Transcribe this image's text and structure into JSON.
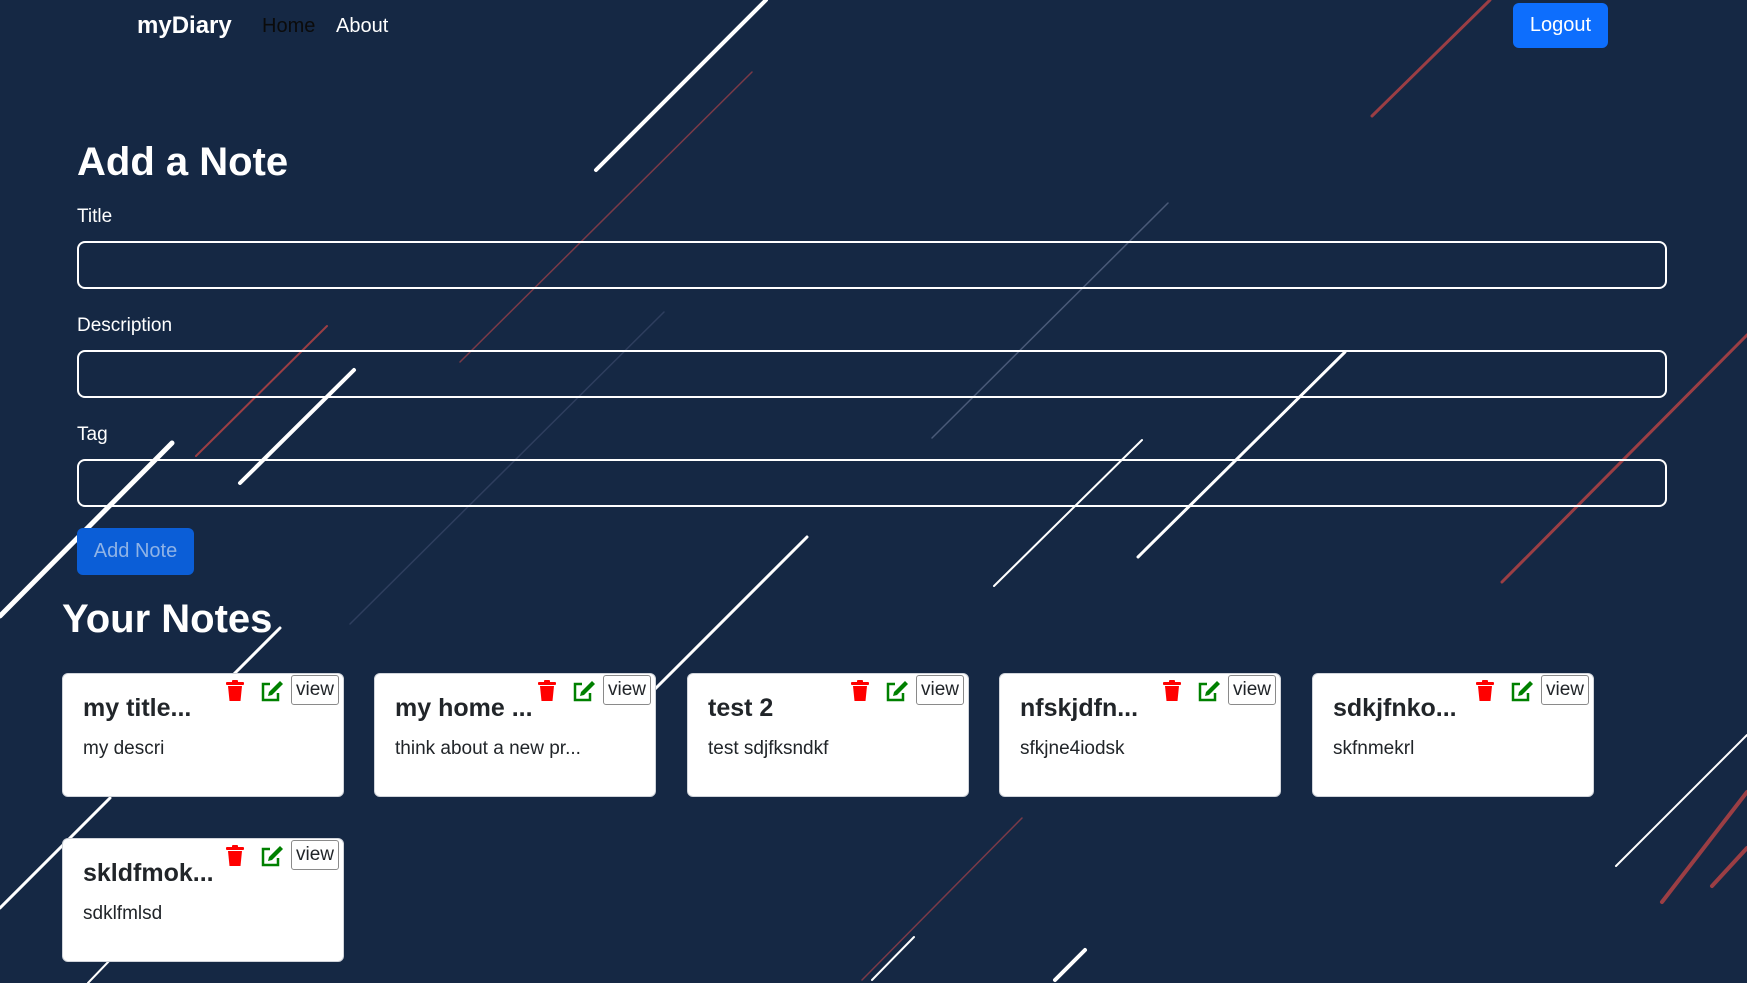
{
  "navbar": {
    "brand": "myDiary",
    "links": [
      "Home",
      "About"
    ],
    "logout_label": "Logout"
  },
  "form": {
    "heading": "Add a Note",
    "title_label": "Title",
    "title_value": "",
    "description_label": "Description",
    "description_value": "",
    "tag_label": "Tag",
    "tag_value": "",
    "submit_label": "Add Note"
  },
  "notes": {
    "heading": "Your Notes",
    "view_label": "view",
    "items": [
      {
        "title": "my title...",
        "description": "my descri"
      },
      {
        "title": "my home ...",
        "description": "think about a new pr..."
      },
      {
        "title": "test 2",
        "description": "test sdjfksndkf"
      },
      {
        "title": "nfskjdfn...",
        "description": "sfkjne4iodsk"
      },
      {
        "title": "sdkjfnko...",
        "description": "skfnmekrl"
      },
      {
        "title": "skldfmok...",
        "description": "sdklfmlsd"
      }
    ]
  },
  "colors": {
    "background": "#152844",
    "primary_button": "#0d6efd",
    "delete_icon": "#ff0000",
    "edit_icon": "#008000",
    "card_background": "#ffffff"
  },
  "icons": [
    "trash-icon",
    "edit-icon"
  ]
}
